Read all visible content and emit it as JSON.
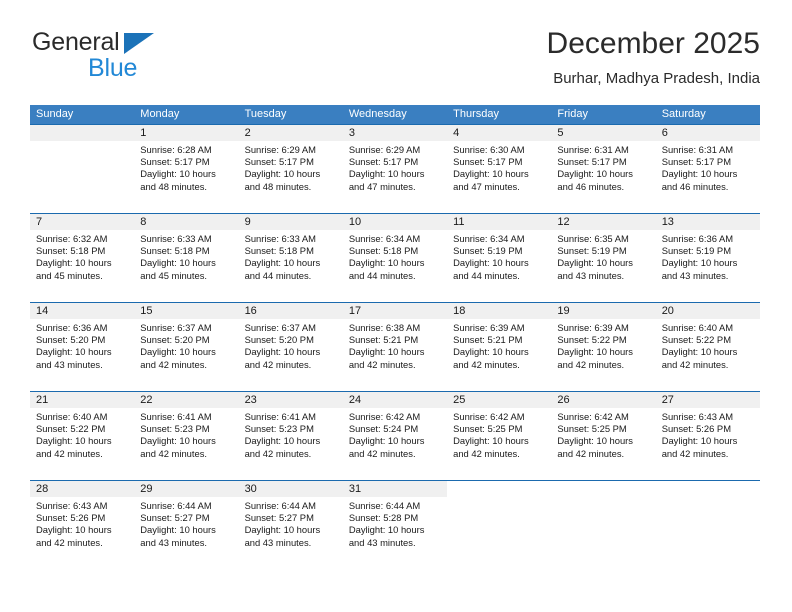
{
  "brand": {
    "name_part1": "General",
    "name_part2": "Blue",
    "triangle_color": "#1b72b8",
    "blue_text_color": "#2288d6"
  },
  "header": {
    "title": "December 2025",
    "subtitle": "Burhar, Madhya Pradesh, India"
  },
  "colors": {
    "header_row_bg": "#3a7fc1",
    "row_divider": "#1b6aae",
    "daynum_band_bg": "#f0f0f0",
    "cell_bg": "#ffffff",
    "text": "#1a1a1a"
  },
  "weekdays": [
    "Sunday",
    "Monday",
    "Tuesday",
    "Wednesday",
    "Thursday",
    "Friday",
    "Saturday"
  ],
  "weeks": [
    [
      {
        "day": "",
        "empty": true,
        "sunrise": "",
        "sunset": "",
        "daylight": ""
      },
      {
        "day": "1",
        "sunrise": "Sunrise: 6:28 AM",
        "sunset": "Sunset: 5:17 PM",
        "daylight": "Daylight: 10 hours and 48 minutes."
      },
      {
        "day": "2",
        "sunrise": "Sunrise: 6:29 AM",
        "sunset": "Sunset: 5:17 PM",
        "daylight": "Daylight: 10 hours and 48 minutes."
      },
      {
        "day": "3",
        "sunrise": "Sunrise: 6:29 AM",
        "sunset": "Sunset: 5:17 PM",
        "daylight": "Daylight: 10 hours and 47 minutes."
      },
      {
        "day": "4",
        "sunrise": "Sunrise: 6:30 AM",
        "sunset": "Sunset: 5:17 PM",
        "daylight": "Daylight: 10 hours and 47 minutes."
      },
      {
        "day": "5",
        "sunrise": "Sunrise: 6:31 AM",
        "sunset": "Sunset: 5:17 PM",
        "daylight": "Daylight: 10 hours and 46 minutes."
      },
      {
        "day": "6",
        "sunrise": "Sunrise: 6:31 AM",
        "sunset": "Sunset: 5:17 PM",
        "daylight": "Daylight: 10 hours and 46 minutes."
      }
    ],
    [
      {
        "day": "7",
        "sunrise": "Sunrise: 6:32 AM",
        "sunset": "Sunset: 5:18 PM",
        "daylight": "Daylight: 10 hours and 45 minutes."
      },
      {
        "day": "8",
        "sunrise": "Sunrise: 6:33 AM",
        "sunset": "Sunset: 5:18 PM",
        "daylight": "Daylight: 10 hours and 45 minutes."
      },
      {
        "day": "9",
        "sunrise": "Sunrise: 6:33 AM",
        "sunset": "Sunset: 5:18 PM",
        "daylight": "Daylight: 10 hours and 44 minutes."
      },
      {
        "day": "10",
        "sunrise": "Sunrise: 6:34 AM",
        "sunset": "Sunset: 5:18 PM",
        "daylight": "Daylight: 10 hours and 44 minutes."
      },
      {
        "day": "11",
        "sunrise": "Sunrise: 6:34 AM",
        "sunset": "Sunset: 5:19 PM",
        "daylight": "Daylight: 10 hours and 44 minutes."
      },
      {
        "day": "12",
        "sunrise": "Sunrise: 6:35 AM",
        "sunset": "Sunset: 5:19 PM",
        "daylight": "Daylight: 10 hours and 43 minutes."
      },
      {
        "day": "13",
        "sunrise": "Sunrise: 6:36 AM",
        "sunset": "Sunset: 5:19 PM",
        "daylight": "Daylight: 10 hours and 43 minutes."
      }
    ],
    [
      {
        "day": "14",
        "sunrise": "Sunrise: 6:36 AM",
        "sunset": "Sunset: 5:20 PM",
        "daylight": "Daylight: 10 hours and 43 minutes."
      },
      {
        "day": "15",
        "sunrise": "Sunrise: 6:37 AM",
        "sunset": "Sunset: 5:20 PM",
        "daylight": "Daylight: 10 hours and 42 minutes."
      },
      {
        "day": "16",
        "sunrise": "Sunrise: 6:37 AM",
        "sunset": "Sunset: 5:20 PM",
        "daylight": "Daylight: 10 hours and 42 minutes."
      },
      {
        "day": "17",
        "sunrise": "Sunrise: 6:38 AM",
        "sunset": "Sunset: 5:21 PM",
        "daylight": "Daylight: 10 hours and 42 minutes."
      },
      {
        "day": "18",
        "sunrise": "Sunrise: 6:39 AM",
        "sunset": "Sunset: 5:21 PM",
        "daylight": "Daylight: 10 hours and 42 minutes."
      },
      {
        "day": "19",
        "sunrise": "Sunrise: 6:39 AM",
        "sunset": "Sunset: 5:22 PM",
        "daylight": "Daylight: 10 hours and 42 minutes."
      },
      {
        "day": "20",
        "sunrise": "Sunrise: 6:40 AM",
        "sunset": "Sunset: 5:22 PM",
        "daylight": "Daylight: 10 hours and 42 minutes."
      }
    ],
    [
      {
        "day": "21",
        "sunrise": "Sunrise: 6:40 AM",
        "sunset": "Sunset: 5:22 PM",
        "daylight": "Daylight: 10 hours and 42 minutes."
      },
      {
        "day": "22",
        "sunrise": "Sunrise: 6:41 AM",
        "sunset": "Sunset: 5:23 PM",
        "daylight": "Daylight: 10 hours and 42 minutes."
      },
      {
        "day": "23",
        "sunrise": "Sunrise: 6:41 AM",
        "sunset": "Sunset: 5:23 PM",
        "daylight": "Daylight: 10 hours and 42 minutes."
      },
      {
        "day": "24",
        "sunrise": "Sunrise: 6:42 AM",
        "sunset": "Sunset: 5:24 PM",
        "daylight": "Daylight: 10 hours and 42 minutes."
      },
      {
        "day": "25",
        "sunrise": "Sunrise: 6:42 AM",
        "sunset": "Sunset: 5:25 PM",
        "daylight": "Daylight: 10 hours and 42 minutes."
      },
      {
        "day": "26",
        "sunrise": "Sunrise: 6:42 AM",
        "sunset": "Sunset: 5:25 PM",
        "daylight": "Daylight: 10 hours and 42 minutes."
      },
      {
        "day": "27",
        "sunrise": "Sunrise: 6:43 AM",
        "sunset": "Sunset: 5:26 PM",
        "daylight": "Daylight: 10 hours and 42 minutes."
      }
    ],
    [
      {
        "day": "28",
        "sunrise": "Sunrise: 6:43 AM",
        "sunset": "Sunset: 5:26 PM",
        "daylight": "Daylight: 10 hours and 42 minutes."
      },
      {
        "day": "29",
        "sunrise": "Sunrise: 6:44 AM",
        "sunset": "Sunset: 5:27 PM",
        "daylight": "Daylight: 10 hours and 43 minutes."
      },
      {
        "day": "30",
        "sunrise": "Sunrise: 6:44 AM",
        "sunset": "Sunset: 5:27 PM",
        "daylight": "Daylight: 10 hours and 43 minutes."
      },
      {
        "day": "31",
        "sunrise": "Sunrise: 6:44 AM",
        "sunset": "Sunset: 5:28 PM",
        "daylight": "Daylight: 10 hours and 43 minutes."
      },
      {
        "day": "",
        "empty": true,
        "blank": true,
        "sunrise": "",
        "sunset": "",
        "daylight": ""
      },
      {
        "day": "",
        "empty": true,
        "blank": true,
        "sunrise": "",
        "sunset": "",
        "daylight": ""
      },
      {
        "day": "",
        "empty": true,
        "blank": true,
        "sunrise": "",
        "sunset": "",
        "daylight": ""
      }
    ]
  ]
}
